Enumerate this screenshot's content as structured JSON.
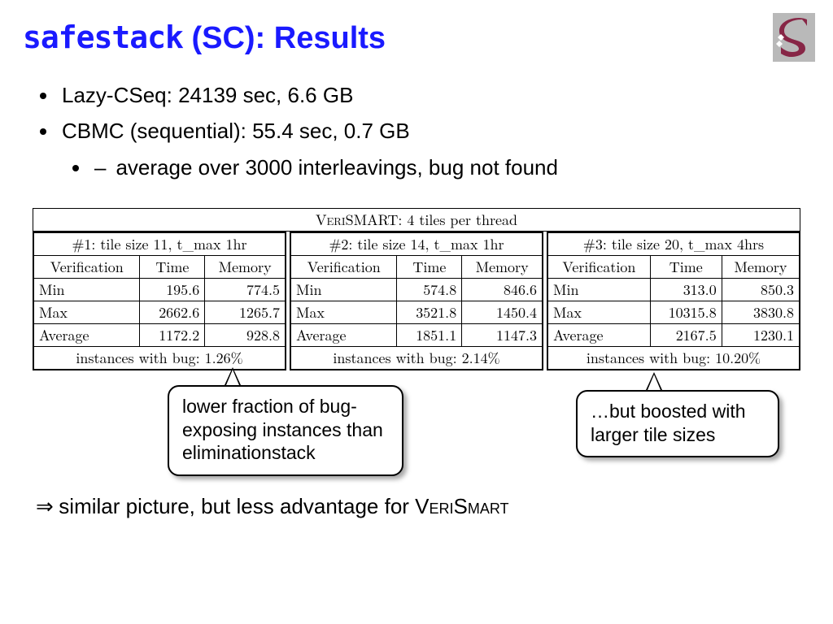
{
  "title_mono": "safestack",
  "title_rest": " (SC): Results",
  "bullets": {
    "b1": "Lazy-CSeq: 24139 sec, 6.6 GB",
    "b2": "CBMC (sequential): 55.4 sec, 0.7 GB",
    "sub1": "average over 3000 interleavings, bug not found"
  },
  "table": {
    "caption_pre": "V",
    "caption_sc": "eri",
    "caption_mid": "SMART: 4 tiles per thread",
    "blocks": [
      {
        "hdr": "#1: tile size 11, t_max 1hr",
        "cols": [
          "Verification",
          "Time",
          "Memory"
        ],
        "rows": [
          [
            "Min",
            "195.6",
            "774.5"
          ],
          [
            "Max",
            "2662.6",
            "1265.7"
          ],
          [
            "Average",
            "1172.2",
            "928.8"
          ]
        ],
        "bug": "instances with bug: 1.26%"
      },
      {
        "hdr": "#2: tile size 14, t_max 1hr",
        "cols": [
          "Verification",
          "Time",
          "Memory"
        ],
        "rows": [
          [
            "Min",
            "574.8",
            "846.6"
          ],
          [
            "Max",
            "3521.8",
            "1450.4"
          ],
          [
            "Average",
            "1851.1",
            "1147.3"
          ]
        ],
        "bug": "instances with bug: 2.14%"
      },
      {
        "hdr": "#3: tile size 20, t_max 4hrs",
        "cols": [
          "Verification",
          "Time",
          "Memory"
        ],
        "rows": [
          [
            "Min",
            "313.0",
            "850.3"
          ],
          [
            "Max",
            "10315.8",
            "3830.8"
          ],
          [
            "Average",
            "2167.5",
            "1230.1"
          ]
        ],
        "bug": "instances with bug: 10.20%"
      }
    ]
  },
  "callouts": {
    "c1": "lower fraction of bug-exposing instances than eliminationstack",
    "c2": "…but boosted with larger tile sizes"
  },
  "conclusion_pre": "similar picture, but less advantage for ",
  "conclusion_v": "V",
  "conclusion_eri": "eri",
  "conclusion_s": "S",
  "conclusion_mart": "mart"
}
